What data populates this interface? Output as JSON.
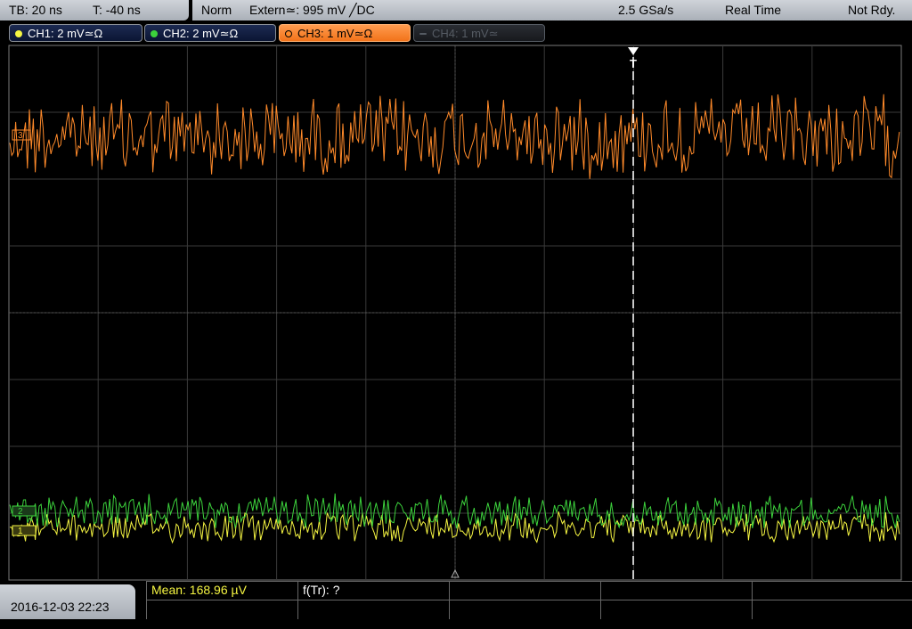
{
  "timebase": {
    "tb": "TB: 20 ns",
    "t": "T: -40 ns"
  },
  "status": {
    "mode": "Norm",
    "trigger": "Extern≃: 995 mV ╱DC",
    "sample_rate": "2.5 GSa/s",
    "acq": "Real Time",
    "state": "Not Rdy."
  },
  "channels": [
    {
      "label": "CH1: 2 mV≃Ω",
      "color": "#f5f542"
    },
    {
      "label": "CH2: 2 mV≃Ω",
      "color": "#3cd23c"
    },
    {
      "label": "CH3: 1 mV≃Ω",
      "color": "#ff8a2a"
    },
    {
      "label": "CH4: 1 mV≃",
      "color": "#555b63"
    }
  ],
  "markers": {
    "trigger": "T",
    "ch3": "3",
    "ch2": "2",
    "ch1": "1"
  },
  "footer": {
    "date": "2016-12-03 22:23",
    "mean": "Mean: 168.96 µV",
    "ftr": "f(Tr): ?"
  },
  "colors": {
    "ch1": "#f5f542",
    "ch2": "#3cd23c",
    "ch3": "#ff8a2a",
    "grid": "#5a5a5a"
  }
}
